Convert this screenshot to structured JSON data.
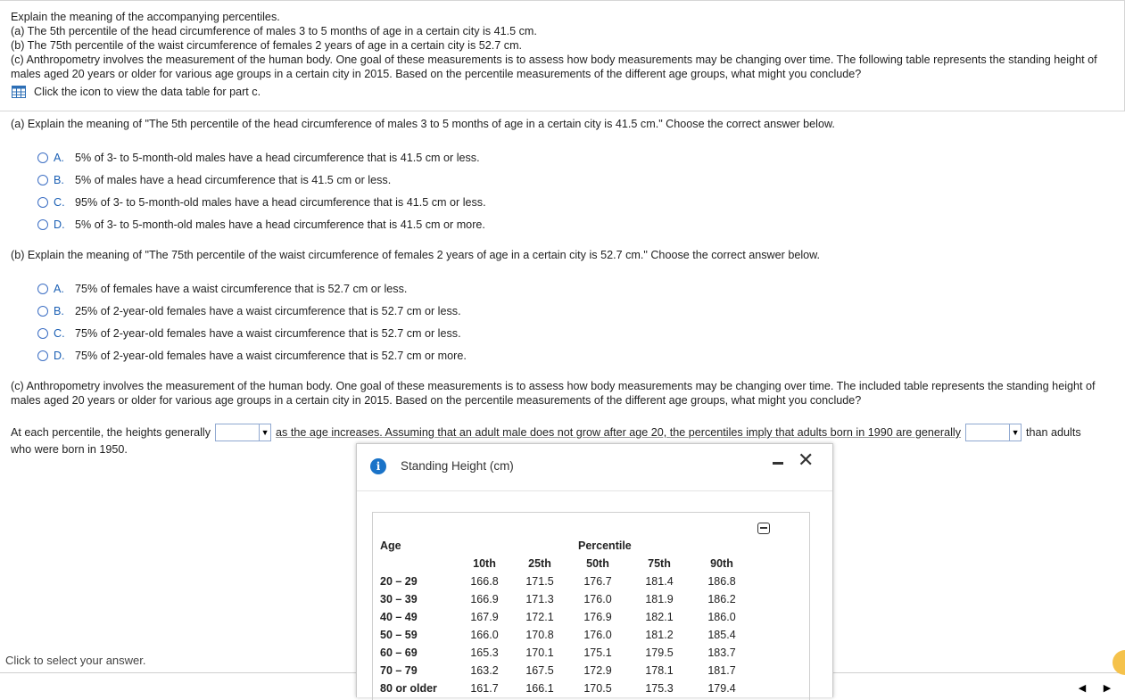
{
  "intro": {
    "l1": "Explain the meaning of the accompanying percentiles.",
    "l2": "(a) The 5th percentile of the head circumference of males 3 to 5 months of age in a certain city is 41.5 cm.",
    "l3": "(b) The 75th percentile of the waist circumference of females 2 years of age in a certain city is 52.7 cm.",
    "l4": "(c) Anthropometry involves the measurement of the human body. One goal of these measurements is to assess how body measurements may be changing over time. The following table represents the standing height of males aged 20 years or older for various age groups in a certain city in 2015. Based on the percentile measurements of the different age groups, what might you conclude?",
    "icon_link": "Click the icon to view the data table for part c.",
    "icon": "grid-table-icon"
  },
  "part_a": {
    "question": "(a) Explain the meaning of \"The 5th percentile of the head circumference of males 3 to 5 months of age in a certain city is 41.5 cm.\" Choose the correct answer below.",
    "options": [
      {
        "letter": "A.",
        "text": "5% of 3- to 5-month-old males have a head circumference that is 41.5 cm or less."
      },
      {
        "letter": "B.",
        "text": "5% of males have a head circumference that is 41.5 cm or less."
      },
      {
        "letter": "C.",
        "text": "95% of 3- to 5-month-old males have a head circumference that is 41.5 cm or less."
      },
      {
        "letter": "D.",
        "text": "5% of 3- to 5-month-old males have a head circumference that is 41.5 cm or more."
      }
    ]
  },
  "part_b": {
    "question": "(b) Explain the meaning of \"The 75th percentile of the waist circumference of females 2 years of age in a certain city is 52.7 cm.\" Choose the correct answer below.",
    "options": [
      {
        "letter": "A.",
        "text": "75% of females have a waist circumference that is 52.7 cm or less."
      },
      {
        "letter": "B.",
        "text": "25% of 2-year-old females have a waist circumference that is 52.7 cm or less."
      },
      {
        "letter": "C.",
        "text": "75% of 2-year-old females have a waist circumference that is 52.7 cm or less."
      },
      {
        "letter": "D.",
        "text": "75% of 2-year-old females have a waist circumference that is 52.7 cm or more."
      }
    ]
  },
  "part_c": {
    "question": "(c) Anthropometry involves the measurement of the human body. One goal of these measurements is to assess how body measurements may be changing over time. The included table represents the standing height of males aged 20 years or older for various age groups in a certain city in 2015. Based on the percentile measurements of the different age groups, what might you conclude?",
    "fill_1": "At each percentile, the heights generally",
    "fill_2": "as the age increases. Assuming that an adult male does not grow after age 20, the percentiles imply that adults born in 1990 are generally",
    "fill_3": "than adults",
    "fill_4": "who were born in 1950.",
    "dropdown_1_value": "",
    "dropdown_2_value": ""
  },
  "footer": {
    "hint": "Click to select your answer."
  },
  "popup": {
    "title": "Standing Height (cm)",
    "table": {
      "age_header": "Age",
      "group_header": "Percentile",
      "columns": [
        "10th",
        "25th",
        "50th",
        "75th",
        "90th"
      ],
      "rows": [
        {
          "age": "20 – 29",
          "values": [
            "166.8",
            "171.5",
            "176.7",
            "181.4",
            "186.8"
          ]
        },
        {
          "age": "30 – 39",
          "values": [
            "166.9",
            "171.3",
            "176.0",
            "181.9",
            "186.2"
          ]
        },
        {
          "age": "40 – 49",
          "values": [
            "167.9",
            "172.1",
            "176.9",
            "182.1",
            "186.0"
          ]
        },
        {
          "age": "50 – 59",
          "values": [
            "166.0",
            "170.8",
            "176.0",
            "181.2",
            "185.4"
          ]
        },
        {
          "age": "60 – 69",
          "values": [
            "165.3",
            "170.1",
            "175.1",
            "179.5",
            "183.7"
          ]
        },
        {
          "age": "70 – 79",
          "values": [
            "163.2",
            "167.5",
            "172.9",
            "178.1",
            "181.7"
          ]
        },
        {
          "age": "80 or older",
          "values": [
            "161.7",
            "166.1",
            "170.5",
            "175.3",
            "179.4"
          ]
        }
      ]
    }
  },
  "colors": {
    "link_blue": "#1a5fb4",
    "info_blue": "#1a73c8",
    "help_yellow": "#f5c24b"
  }
}
